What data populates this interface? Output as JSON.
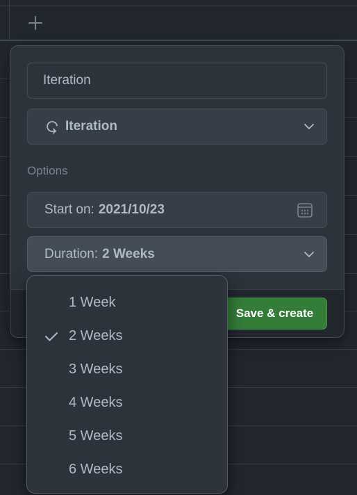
{
  "toolbar": {
    "add_icon": "plus-icon"
  },
  "form": {
    "field_name_value": "Iteration",
    "field_type_label": "Iteration",
    "field_type_icon": "iteration-icon",
    "options_heading": "Options",
    "start_label": "Start on:",
    "start_value": "2021/10/23",
    "duration_label": "Duration:",
    "duration_value": "2 Weeks",
    "save_button": "Save & create"
  },
  "duration_menu": {
    "selected": "2 Weeks",
    "items": [
      {
        "label": "1 Week"
      },
      {
        "label": "2 Weeks"
      },
      {
        "label": "3 Weeks"
      },
      {
        "label": "4 Weeks"
      },
      {
        "label": "5 Weeks"
      },
      {
        "label": "6 Weeks"
      }
    ]
  },
  "colors": {
    "background": "#22272e",
    "panel": "#2d333b",
    "accent_green": "#347d39",
    "text": "#adbac7",
    "muted": "#768390"
  }
}
